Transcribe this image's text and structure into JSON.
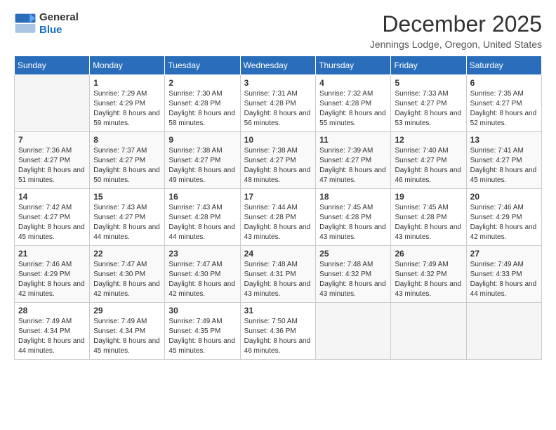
{
  "logo": {
    "text_general": "General",
    "text_blue": "Blue"
  },
  "header": {
    "title": "December 2025",
    "location": "Jennings Lodge, Oregon, United States"
  },
  "days_of_week": [
    "Sunday",
    "Monday",
    "Tuesday",
    "Wednesday",
    "Thursday",
    "Friday",
    "Saturday"
  ],
  "weeks": [
    [
      {
        "day": "",
        "sunrise": "",
        "sunset": "",
        "daylight": "",
        "empty": true
      },
      {
        "day": "1",
        "sunrise": "Sunrise: 7:29 AM",
        "sunset": "Sunset: 4:29 PM",
        "daylight": "Daylight: 8 hours and 59 minutes."
      },
      {
        "day": "2",
        "sunrise": "Sunrise: 7:30 AM",
        "sunset": "Sunset: 4:28 PM",
        "daylight": "Daylight: 8 hours and 58 minutes."
      },
      {
        "day": "3",
        "sunrise": "Sunrise: 7:31 AM",
        "sunset": "Sunset: 4:28 PM",
        "daylight": "Daylight: 8 hours and 56 minutes."
      },
      {
        "day": "4",
        "sunrise": "Sunrise: 7:32 AM",
        "sunset": "Sunset: 4:28 PM",
        "daylight": "Daylight: 8 hours and 55 minutes."
      },
      {
        "day": "5",
        "sunrise": "Sunrise: 7:33 AM",
        "sunset": "Sunset: 4:27 PM",
        "daylight": "Daylight: 8 hours and 53 minutes."
      },
      {
        "day": "6",
        "sunrise": "Sunrise: 7:35 AM",
        "sunset": "Sunset: 4:27 PM",
        "daylight": "Daylight: 8 hours and 52 minutes."
      }
    ],
    [
      {
        "day": "7",
        "sunrise": "Sunrise: 7:36 AM",
        "sunset": "Sunset: 4:27 PM",
        "daylight": "Daylight: 8 hours and 51 minutes."
      },
      {
        "day": "8",
        "sunrise": "Sunrise: 7:37 AM",
        "sunset": "Sunset: 4:27 PM",
        "daylight": "Daylight: 8 hours and 50 minutes."
      },
      {
        "day": "9",
        "sunrise": "Sunrise: 7:38 AM",
        "sunset": "Sunset: 4:27 PM",
        "daylight": "Daylight: 8 hours and 49 minutes."
      },
      {
        "day": "10",
        "sunrise": "Sunrise: 7:38 AM",
        "sunset": "Sunset: 4:27 PM",
        "daylight": "Daylight: 8 hours and 48 minutes."
      },
      {
        "day": "11",
        "sunrise": "Sunrise: 7:39 AM",
        "sunset": "Sunset: 4:27 PM",
        "daylight": "Daylight: 8 hours and 47 minutes."
      },
      {
        "day": "12",
        "sunrise": "Sunrise: 7:40 AM",
        "sunset": "Sunset: 4:27 PM",
        "daylight": "Daylight: 8 hours and 46 minutes."
      },
      {
        "day": "13",
        "sunrise": "Sunrise: 7:41 AM",
        "sunset": "Sunset: 4:27 PM",
        "daylight": "Daylight: 8 hours and 45 minutes."
      }
    ],
    [
      {
        "day": "14",
        "sunrise": "Sunrise: 7:42 AM",
        "sunset": "Sunset: 4:27 PM",
        "daylight": "Daylight: 8 hours and 45 minutes."
      },
      {
        "day": "15",
        "sunrise": "Sunrise: 7:43 AM",
        "sunset": "Sunset: 4:27 PM",
        "daylight": "Daylight: 8 hours and 44 minutes."
      },
      {
        "day": "16",
        "sunrise": "Sunrise: 7:43 AM",
        "sunset": "Sunset: 4:28 PM",
        "daylight": "Daylight: 8 hours and 44 minutes."
      },
      {
        "day": "17",
        "sunrise": "Sunrise: 7:44 AM",
        "sunset": "Sunset: 4:28 PM",
        "daylight": "Daylight: 8 hours and 43 minutes."
      },
      {
        "day": "18",
        "sunrise": "Sunrise: 7:45 AM",
        "sunset": "Sunset: 4:28 PM",
        "daylight": "Daylight: 8 hours and 43 minutes."
      },
      {
        "day": "19",
        "sunrise": "Sunrise: 7:45 AM",
        "sunset": "Sunset: 4:28 PM",
        "daylight": "Daylight: 8 hours and 43 minutes."
      },
      {
        "day": "20",
        "sunrise": "Sunrise: 7:46 AM",
        "sunset": "Sunset: 4:29 PM",
        "daylight": "Daylight: 8 hours and 42 minutes."
      }
    ],
    [
      {
        "day": "21",
        "sunrise": "Sunrise: 7:46 AM",
        "sunset": "Sunset: 4:29 PM",
        "daylight": "Daylight: 8 hours and 42 minutes."
      },
      {
        "day": "22",
        "sunrise": "Sunrise: 7:47 AM",
        "sunset": "Sunset: 4:30 PM",
        "daylight": "Daylight: 8 hours and 42 minutes."
      },
      {
        "day": "23",
        "sunrise": "Sunrise: 7:47 AM",
        "sunset": "Sunset: 4:30 PM",
        "daylight": "Daylight: 8 hours and 42 minutes."
      },
      {
        "day": "24",
        "sunrise": "Sunrise: 7:48 AM",
        "sunset": "Sunset: 4:31 PM",
        "daylight": "Daylight: 8 hours and 43 minutes."
      },
      {
        "day": "25",
        "sunrise": "Sunrise: 7:48 AM",
        "sunset": "Sunset: 4:32 PM",
        "daylight": "Daylight: 8 hours and 43 minutes."
      },
      {
        "day": "26",
        "sunrise": "Sunrise: 7:49 AM",
        "sunset": "Sunset: 4:32 PM",
        "daylight": "Daylight: 8 hours and 43 minutes."
      },
      {
        "day": "27",
        "sunrise": "Sunrise: 7:49 AM",
        "sunset": "Sunset: 4:33 PM",
        "daylight": "Daylight: 8 hours and 44 minutes."
      }
    ],
    [
      {
        "day": "28",
        "sunrise": "Sunrise: 7:49 AM",
        "sunset": "Sunset: 4:34 PM",
        "daylight": "Daylight: 8 hours and 44 minutes."
      },
      {
        "day": "29",
        "sunrise": "Sunrise: 7:49 AM",
        "sunset": "Sunset: 4:34 PM",
        "daylight": "Daylight: 8 hours and 45 minutes."
      },
      {
        "day": "30",
        "sunrise": "Sunrise: 7:49 AM",
        "sunset": "Sunset: 4:35 PM",
        "daylight": "Daylight: 8 hours and 45 minutes."
      },
      {
        "day": "31",
        "sunrise": "Sunrise: 7:50 AM",
        "sunset": "Sunset: 4:36 PM",
        "daylight": "Daylight: 8 hours and 46 minutes."
      },
      {
        "day": "",
        "sunrise": "",
        "sunset": "",
        "daylight": "",
        "empty": true
      },
      {
        "day": "",
        "sunrise": "",
        "sunset": "",
        "daylight": "",
        "empty": true
      },
      {
        "day": "",
        "sunrise": "",
        "sunset": "",
        "daylight": "",
        "empty": true
      }
    ]
  ]
}
